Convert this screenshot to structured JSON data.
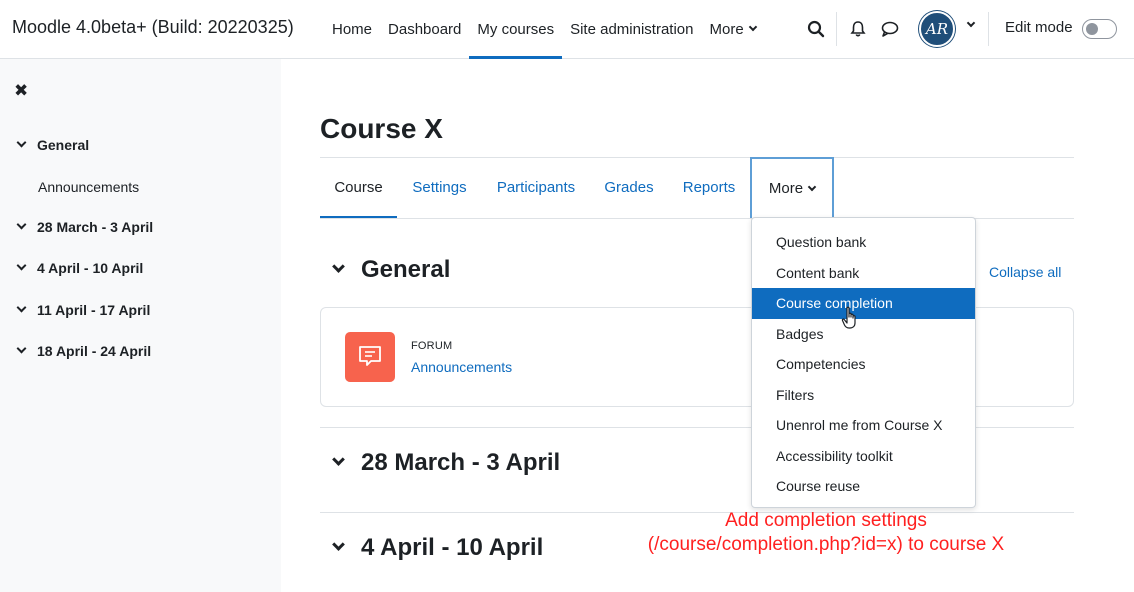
{
  "navbar": {
    "brand": "Moodle 4.0beta+ (Build: 20220325)",
    "items": [
      {
        "label": "Home"
      },
      {
        "label": "Dashboard"
      },
      {
        "label": "My courses"
      },
      {
        "label": "Site administration"
      },
      {
        "label": "More"
      }
    ],
    "edit_mode_label": "Edit mode",
    "avatar_initials": "AR"
  },
  "drawer": {
    "sections": [
      {
        "label": "General"
      },
      {
        "label": "28 March - 3 April"
      },
      {
        "label": "4 April - 10 April"
      },
      {
        "label": "11 April - 17 April"
      },
      {
        "label": "18 April - 24 April"
      }
    ],
    "sub_items": [
      {
        "label": "Announcements"
      }
    ]
  },
  "course": {
    "title": "Course X",
    "tabs": [
      {
        "label": "Course"
      },
      {
        "label": "Settings"
      },
      {
        "label": "Participants"
      },
      {
        "label": "Grades"
      },
      {
        "label": "Reports"
      },
      {
        "label": "More"
      }
    ],
    "collapse_all": "Collapse all",
    "sections": [
      {
        "title": "General"
      },
      {
        "title": "28 March - 3 April"
      },
      {
        "title": "4 April - 10 April"
      }
    ],
    "activity": {
      "type": "FORUM",
      "name": "Announcements"
    }
  },
  "more_menu": {
    "items": [
      {
        "label": "Question bank"
      },
      {
        "label": "Content bank"
      },
      {
        "label": "Course completion"
      },
      {
        "label": "Badges"
      },
      {
        "label": "Competencies"
      },
      {
        "label": "Filters"
      },
      {
        "label": "Unenrol me from Course X"
      },
      {
        "label": "Accessibility toolkit"
      },
      {
        "label": "Course reuse"
      }
    ],
    "highlighted": "Course completion"
  },
  "annotation": {
    "text": "Add completion settings (/course/completion.php?id=x) to course X"
  },
  "colors": {
    "primary": "#0f6cbf",
    "forum": "#f7634d",
    "annotation": "#ff2020"
  }
}
